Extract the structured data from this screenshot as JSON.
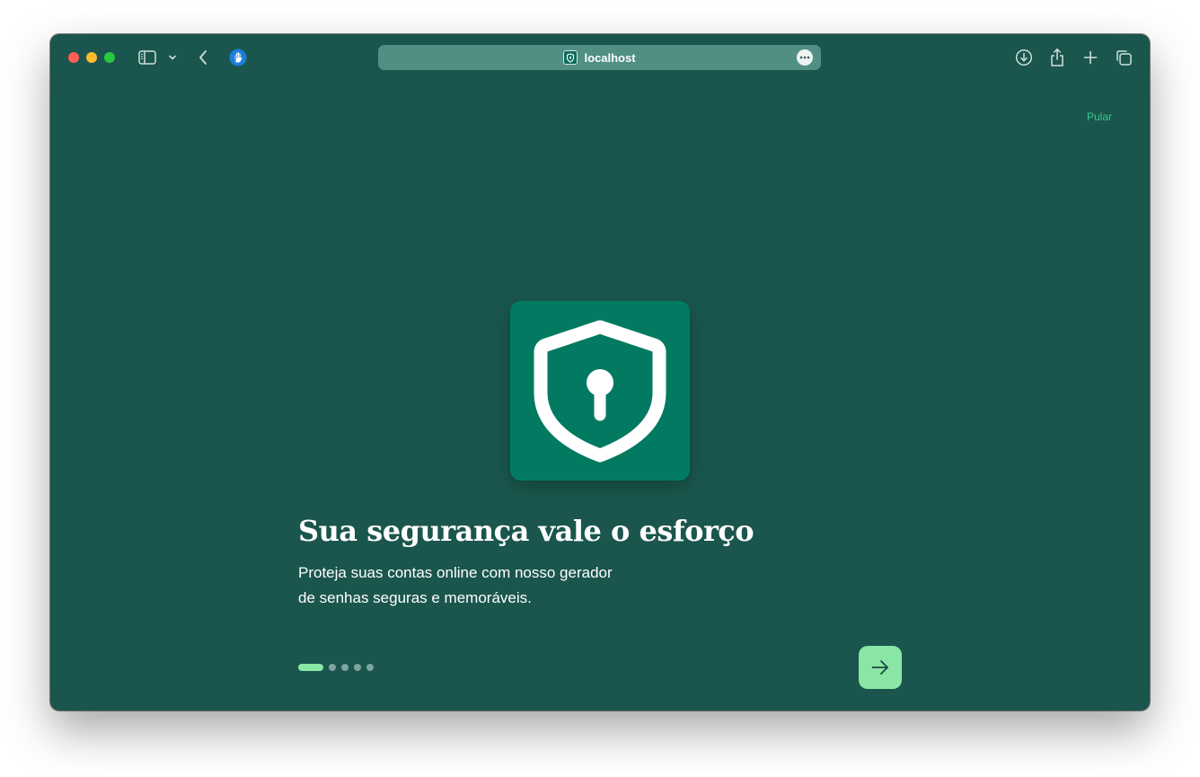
{
  "browser": {
    "url": "localhost",
    "icons": {
      "sidebar": "sidebar-icon",
      "dropdown": "chevron-down-icon",
      "back": "chevron-left-icon",
      "extension": "hand-icon",
      "favicon": "shield-icon",
      "more": "ellipsis-icon",
      "download": "download-icon",
      "share": "share-icon",
      "new_tab": "plus-icon",
      "tabs": "tab-overview-icon"
    }
  },
  "onboarding": {
    "skip_label": "Pular",
    "title": "Sua segurança vale o esforço",
    "subtitle_line1": "Proteja suas contas online com nosso gerador",
    "subtitle_line2": "de senhas seguras e memoráveis.",
    "hero_icon": "shield-keyhole-icon",
    "next_icon": "arrow-right-icon",
    "steps_total": 5,
    "step_current": 1
  },
  "colors": {
    "background": "#1a564d",
    "accent": "#8ae6a4",
    "icon_tile": "#017a61",
    "skip_text": "#35c98c"
  }
}
